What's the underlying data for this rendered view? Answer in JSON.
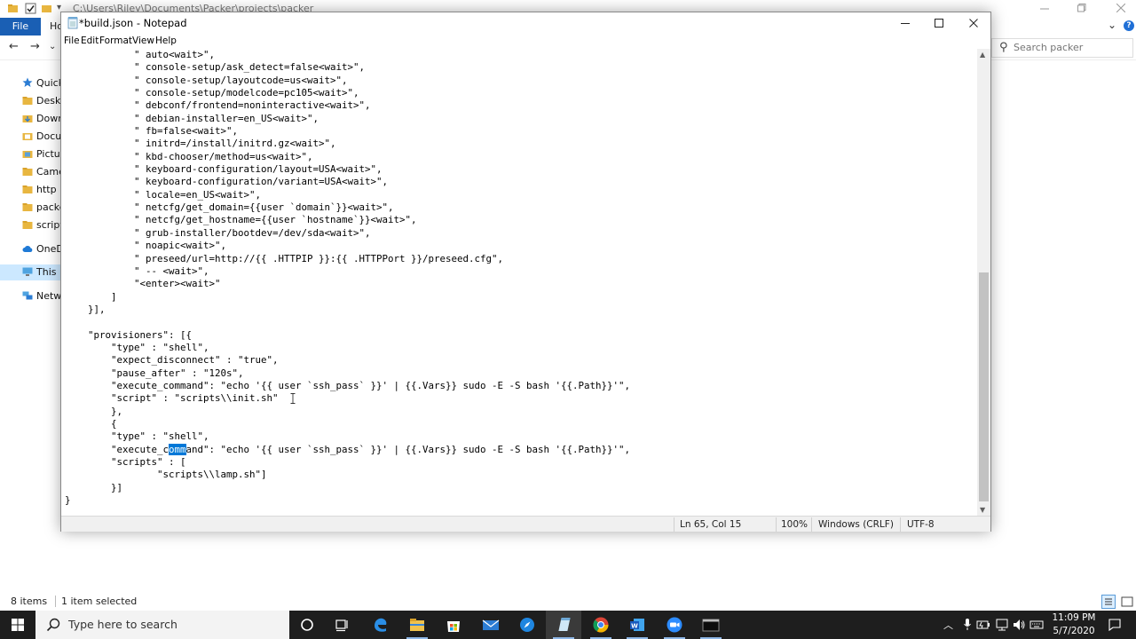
{
  "explorer": {
    "title": "C:\\Users\\Riley\\Documents\\Packer\\projects\\packer",
    "ribbon": {
      "file_tab": "File",
      "home_tab": "Ho"
    },
    "search": {
      "placeholder": "Search packer"
    },
    "nav_items": [
      {
        "label": "Quick a",
        "icon": "star-icon"
      },
      {
        "label": "Deskt",
        "icon": "folder-icon"
      },
      {
        "label": "Down",
        "icon": "download-icon"
      },
      {
        "label": "Docu",
        "icon": "document-icon"
      },
      {
        "label": "Pictur",
        "icon": "picture-icon"
      },
      {
        "label": "Came",
        "icon": "folder-icon"
      },
      {
        "label": "http",
        "icon": "folder-icon"
      },
      {
        "label": "packe",
        "icon": "folder-icon"
      },
      {
        "label": "scripts",
        "icon": "folder-icon"
      },
      {
        "label": "OneDri",
        "icon": "cloud-icon"
      },
      {
        "label": "This PC",
        "icon": "computer-icon"
      },
      {
        "label": "Networ",
        "icon": "network-icon"
      }
    ],
    "status": {
      "items": "8 items",
      "selected": "1 item selected"
    }
  },
  "notepad": {
    "title": "*build.json - Notepad",
    "menu": [
      "File",
      "Edit",
      "Format",
      "View",
      "Help"
    ],
    "code_lines": [
      "            \" auto<wait>\",",
      "            \" console-setup/ask_detect=false<wait>\",",
      "            \" console-setup/layoutcode=us<wait>\",",
      "            \" console-setup/modelcode=pc105<wait>\",",
      "            \" debconf/frontend=noninteractive<wait>\",",
      "            \" debian-installer=en_US<wait>\",",
      "            \" fb=false<wait>\",",
      "            \" initrd=/install/initrd.gz<wait>\",",
      "            \" kbd-chooser/method=us<wait>\",",
      "            \" keyboard-configuration/layout=USA<wait>\",",
      "            \" keyboard-configuration/variant=USA<wait>\",",
      "            \" locale=en_US<wait>\",",
      "            \" netcfg/get_domain={{user `domain`}}<wait>\",",
      "            \" netcfg/get_hostname={{user `hostname`}}<wait>\",",
      "            \" grub-installer/bootdev=/dev/sda<wait>\",",
      "            \" noapic<wait>\",",
      "            \" preseed/url=http://{{ .HTTPIP }}:{{ .HTTPPort }}/preseed.cfg\",",
      "            \" -- <wait>\",",
      "            \"<enter><wait>\"",
      "        ]",
      "    }],",
      "",
      "    \"provisioners\": [{",
      "        \"type\" : \"shell\",",
      "        \"expect_disconnect\" : \"true\",",
      "        \"pause_after\" : \"120s\",",
      "        \"execute_command\": \"echo '{{ user `ssh_pass` }}' | {{.Vars}} sudo -E -S bash '{{.Path}}'\",",
      "        \"script\" : \"scripts\\\\init.sh\"",
      "        },",
      "        {",
      "        \"type\" : \"shell\",",
      "        \"execute_command\": \"echo '{{ user `ssh_pass` }}' | {{.Vars}} sudo -E -S bash '{{.Path}}'\",",
      "        \"scripts\" : [",
      "                \"scripts\\\\lamp.sh\"]",
      "        }]",
      "}"
    ],
    "selection": {
      "line": 31,
      "before": "        \"execute_c",
      "selected": "omm",
      "after": "and\": \"echo '{{ user `ssh_pass` }}' | {{.Vars}} sudo -E -S bash '{{.Path}}'\","
    },
    "status": {
      "position": "Ln 65, Col 15",
      "zoom": "100%",
      "line_ending": "Windows (CRLF)",
      "encoding": "UTF-8"
    }
  },
  "taskbar": {
    "search_placeholder": "Type here to search",
    "time": "11:09 PM",
    "date": "5/7/2020",
    "apps": [
      "cortana-icon",
      "task-view-icon",
      "edge-icon",
      "file-explorer-icon",
      "store-icon",
      "mail-icon",
      "safari-icon",
      "notepad-icon",
      "chrome-icon",
      "word-icon",
      "zoom-icon",
      "terminal-icon"
    ]
  },
  "colors": {
    "selection": "#0078d7",
    "taskbar": "#1e1e1e",
    "explorer_file_tab": "#1a5fb4"
  }
}
